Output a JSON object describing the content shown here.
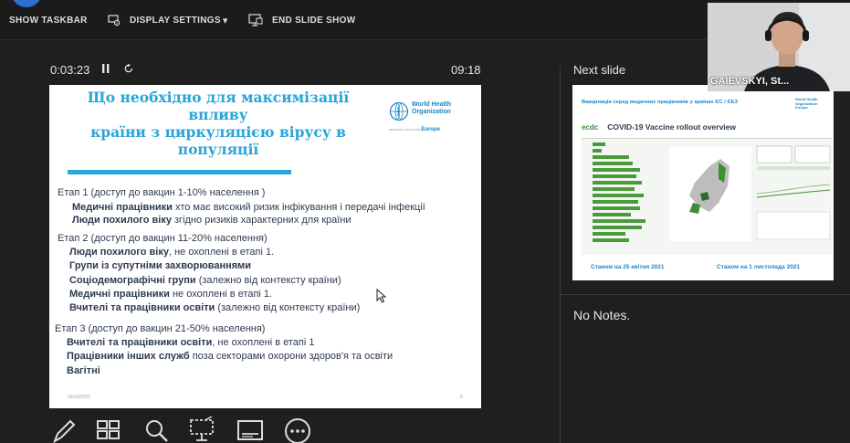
{
  "toolbar": {
    "show_taskbar": "SHOW TASKBAR",
    "display_settings": "DISPLAY SETTINGS",
    "display_settings_caret": "▾",
    "end_slide_show": "END SLIDE SHOW"
  },
  "presenter": {
    "elapsed_time": "0:03:23",
    "clock": "09:18",
    "next_slide_label": "Next slide",
    "notes": "No Notes."
  },
  "current_slide": {
    "title_line1": "Що необхідно для максимізації впливу",
    "title_line2": "країни з циркуляцією вірусу в популяції",
    "who_logo": {
      "line1": "World Health",
      "line2": "Organization",
      "subline": "REGIONAL OFFICE FOR",
      "region": "Europe"
    },
    "stages": [
      {
        "heading": "Етап 1 (доступ до вакцин  1-10% населення )",
        "items": [
          {
            "bold": "Медичні працівники",
            "rest": " хто має високий ризик інфікування і передачі інфекції"
          },
          {
            "bold": "Люди похилого віку",
            "rest": " згідно ризиків характерних для країни"
          }
        ]
      },
      {
        "heading": "Етап 2 (доступ до вакцин  11-20% населення)",
        "items": [
          {
            "bold": "Люди похилого віку",
            "rest": ", не охоплені в етапі 1."
          },
          {
            "bold": "Групи із супутніми захворюваннями",
            "rest": ""
          },
          {
            "bold": "Соціодемографічні групи",
            "rest": " (залежно від контексту країни)"
          },
          {
            "bold": "Медичні працівники",
            "rest": " не охоплені в етапі 1."
          },
          {
            "bold": "Вчителі та працівники освіти",
            "rest": " (залежно від контексту країни)"
          }
        ]
      },
      {
        "heading": "Етап 3 (доступ до вакцин 21-50% населення)",
        "items": [
          {
            "bold": "Вчителі та працівники освіти",
            "rest": ", не охоплені в етапі 1"
          },
          {
            "bold": "Працівники інших служб",
            "rest": " поза секторами охорони здоров'я та освіти"
          },
          {
            "bold": "Вагітні",
            "rest": ""
          }
        ]
      }
    ],
    "date": "03/10/2021",
    "number": "8"
  },
  "next_slide": {
    "title": "Вакцинація серед медичних працівників у країнах ЄС / ЄЕЗ",
    "who_line1": "World Health",
    "who_line2": "Organization",
    "who_region": "Europe",
    "ecdc": "ecdc",
    "banner_title": "COVID-19 Vaccine rollout overview",
    "caption_left": "Станом на 25 квітня 2021",
    "caption_right": "Станом на 1 листопада 2021"
  },
  "webcam": {
    "name": "GAIEVSKYI, St..."
  },
  "icon_names": [
    "taskbar-icon",
    "gear-icon",
    "end-show-icon",
    "pause-icon",
    "restart-icon",
    "pen-icon",
    "grid-icon",
    "zoom-icon",
    "laser-pointer-icon",
    "subtitles-icon",
    "more-icon"
  ],
  "colors": {
    "background": "#1f1f1f",
    "accent_blue": "#2aa4d9",
    "who_blue": "#1b86c4",
    "ecdc_green": "#3f8f3a"
  }
}
